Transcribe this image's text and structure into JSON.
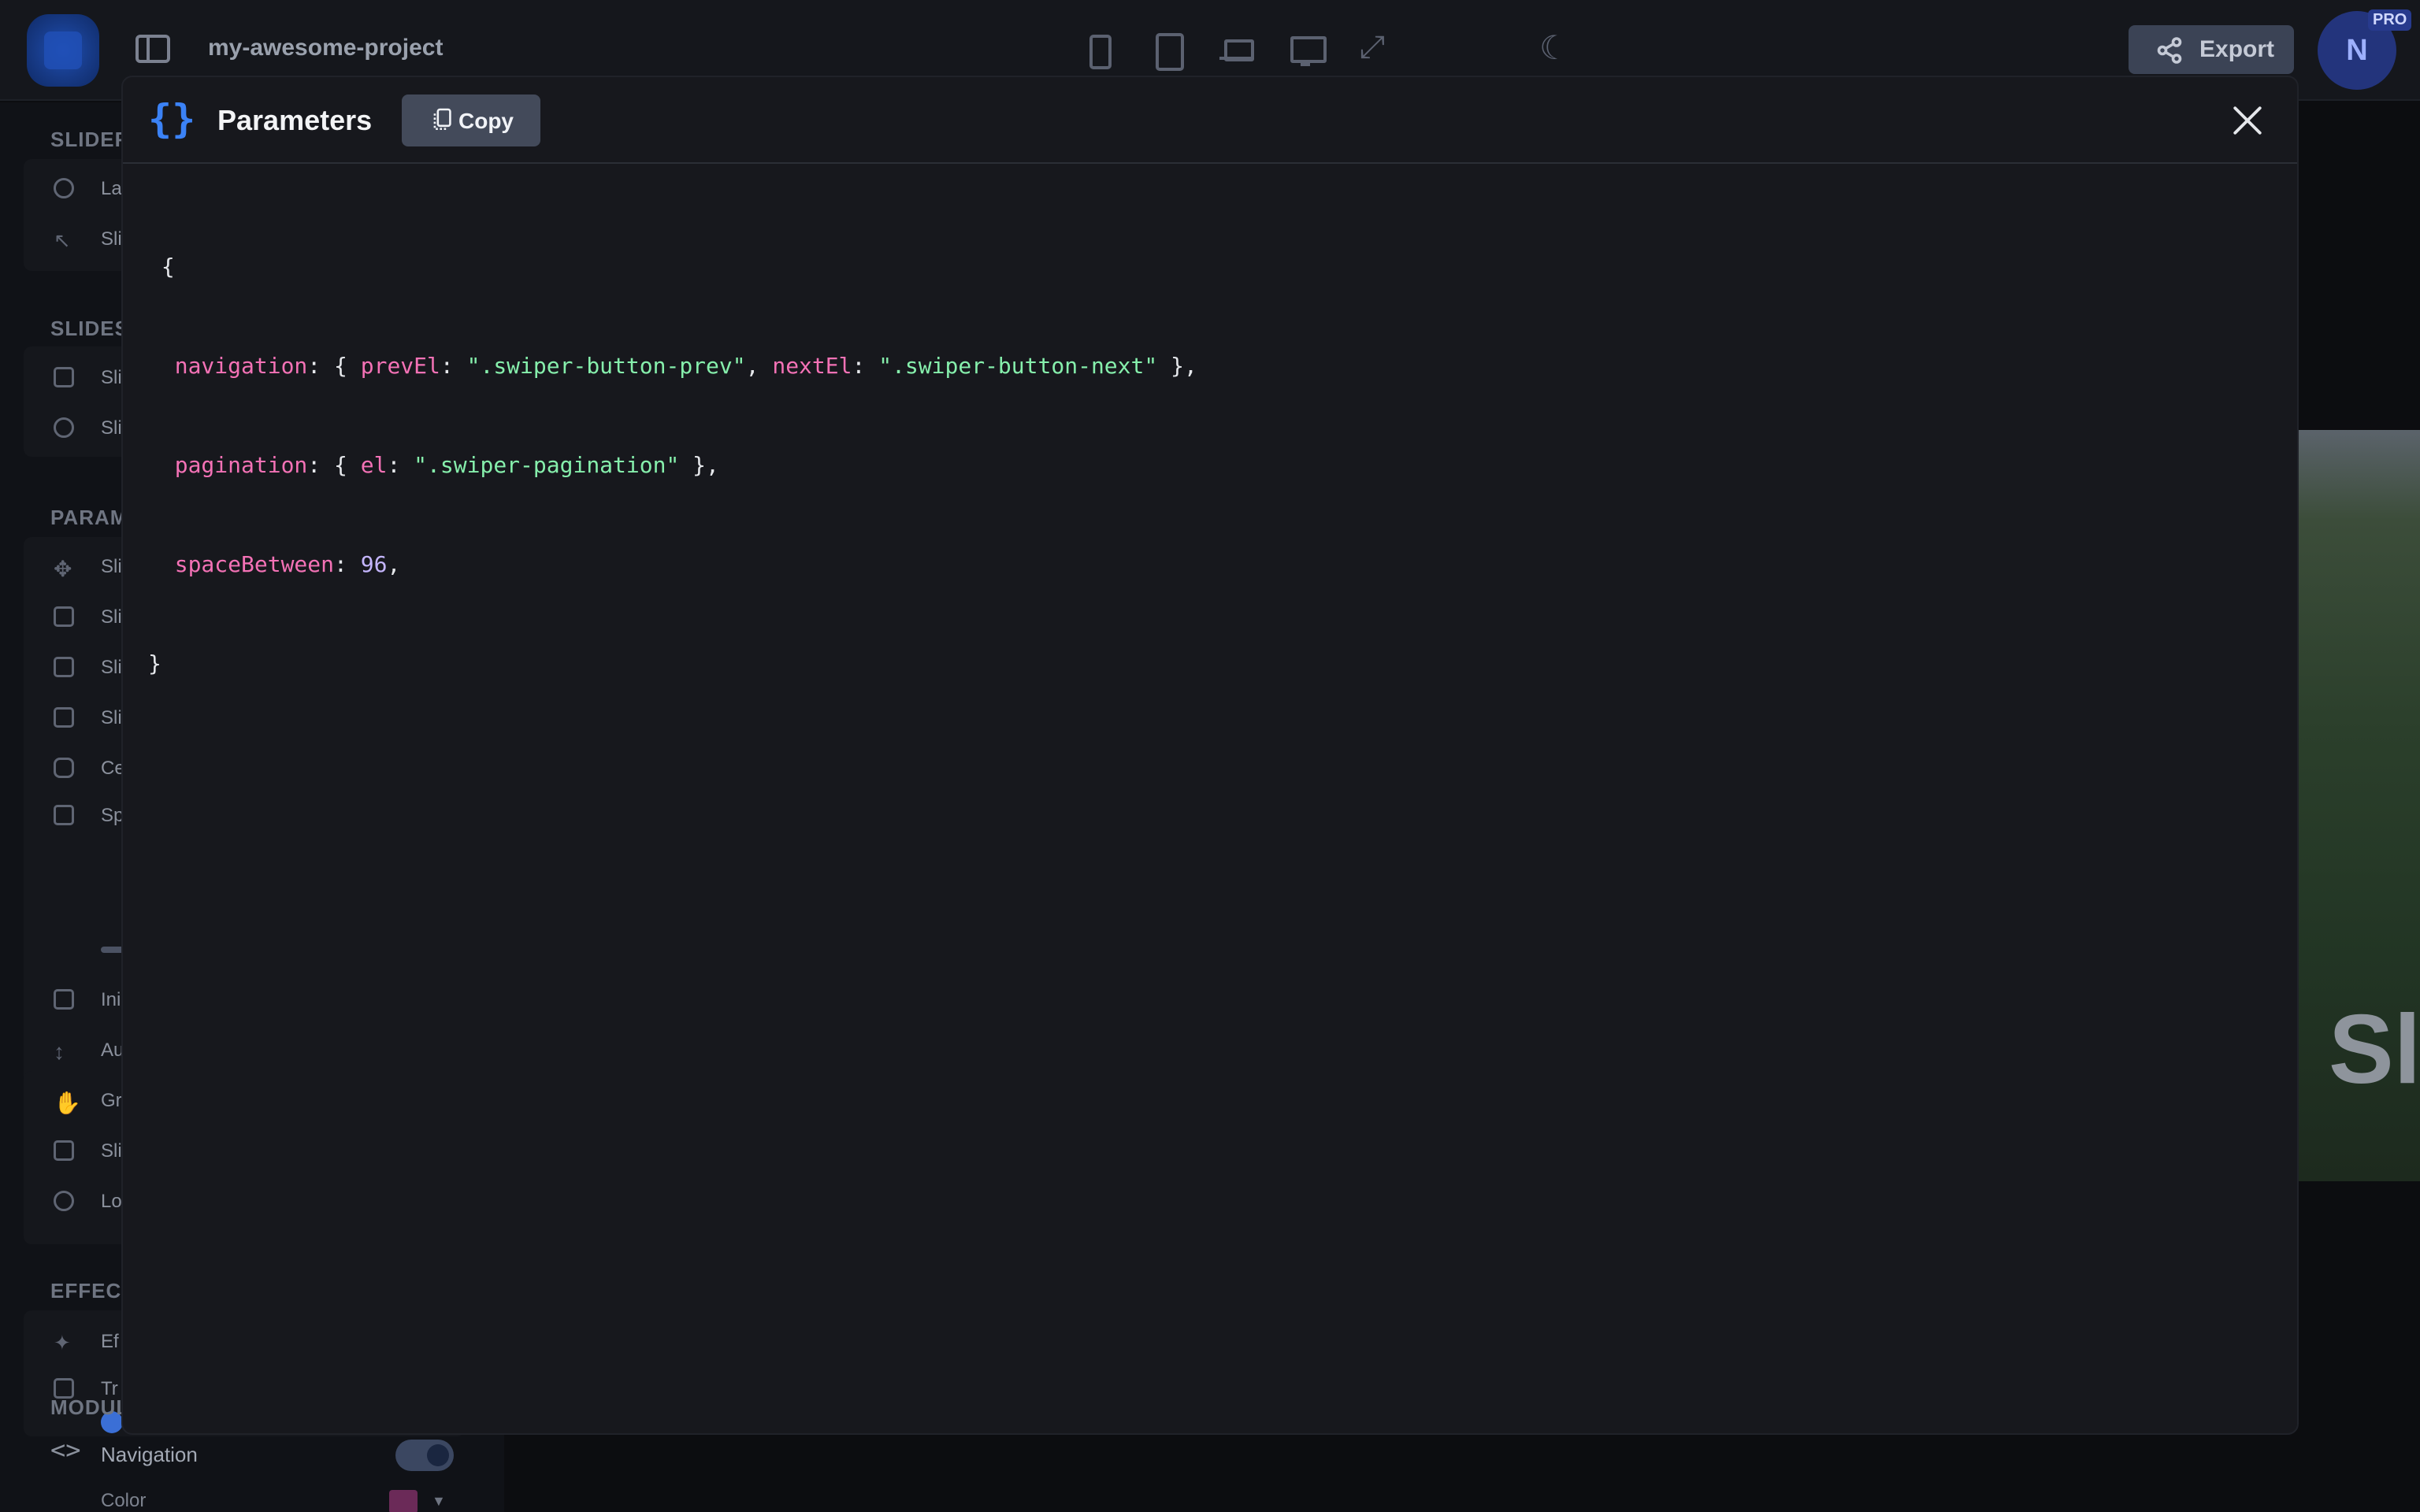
{
  "app": {
    "project_name": "my-awesome-project",
    "export_label": "Export",
    "avatar_initial": "N",
    "pro_badge": "PRO"
  },
  "sidebar": {
    "sections": {
      "slider": "SLIDER",
      "slides": "SLIDES",
      "params": "PARAM",
      "effects": "EFFECT",
      "modules": "MODUL"
    },
    "partial_rows": {
      "r1": "La",
      "r2": "Sli",
      "r3": "Sli",
      "r4": "Sli",
      "r5": "Sli",
      "r6": "Sli",
      "r7": "Sli",
      "r8": "Sli",
      "r9": "Ce",
      "r10": "Sp",
      "r11": "Ini",
      "r12": "Au",
      "r13": "Gr",
      "r14": "Sli",
      "r15": "Lo",
      "r16": "Ef",
      "r17": "Tr"
    },
    "navigation_label": "Navigation",
    "navigation_enabled": true,
    "color_label": "Color",
    "color_value": "#6b2a58"
  },
  "preview": {
    "partial_text": "Sl"
  },
  "modal": {
    "title": "Parameters",
    "copy_label": "Copy",
    "code": {
      "open": "{",
      "close": "}",
      "navigation_key": "navigation",
      "prevEl_key": "prevEl",
      "prevEl_value": "\".swiper-button-prev\"",
      "nextEl_key": "nextEl",
      "nextEl_value": "\".swiper-button-next\"",
      "pagination_key": "pagination",
      "el_key": "el",
      "el_value": "\".swiper-pagination\"",
      "spaceBetween_key": "spaceBetween",
      "spaceBetween_value": "96"
    }
  },
  "colors": {
    "accent": "#3b82f6",
    "code_key": "#f472b6",
    "code_string": "#86efac",
    "code_number": "#c4b5fd"
  }
}
